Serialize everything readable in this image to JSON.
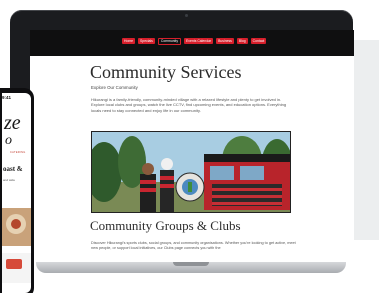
{
  "nav": {
    "items": [
      {
        "label": "Home"
      },
      {
        "label": "Specials"
      },
      {
        "label": "Community"
      },
      {
        "label": "Events Calendar"
      },
      {
        "label": "Business"
      },
      {
        "label": "Blog"
      },
      {
        "label": "Contact"
      }
    ],
    "active_index": 2
  },
  "page": {
    "title": "Community Services",
    "subtitle": "Explore Our Community",
    "intro": "Hikurangi is a family-friendly, community-minded village with a relaxed lifestyle and plenty to get involved in. Explore local clubs and groups, watch the live CCTV, find upcoming events, and education options. Everything locals need to stay connected and enjoy life in our community."
  },
  "section": {
    "title": "Community Groups & Clubs",
    "text": "Discover Hikurangi's sports clubs, social groups, and community organisations. Whether you're looking to get active, meet new people, or support local initiatives, our Clubs page connects you with the"
  },
  "phone": {
    "time": "9:41",
    "logo_line1": "ze",
    "logo_line2": "o",
    "tagline": "CATERING",
    "heading": "oast &",
    "text": "and wide"
  },
  "colors": {
    "accent": "#d71f2b",
    "nav_bg": "#0f0f10",
    "laptop_frame": "#1b1c1f"
  }
}
